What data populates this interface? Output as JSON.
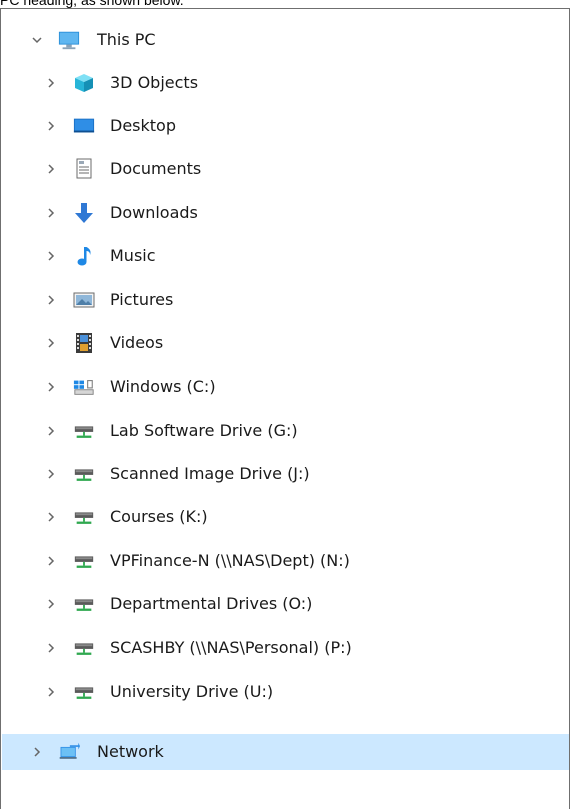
{
  "caption": "PC heading, as shown below.",
  "tree": {
    "root": {
      "label": "This PC",
      "icon": "computer-icon",
      "expanded": true
    },
    "children": [
      {
        "label": "3D Objects",
        "icon": "3d-objects-icon"
      },
      {
        "label": "Desktop",
        "icon": "desktop-icon"
      },
      {
        "label": "Documents",
        "icon": "documents-icon"
      },
      {
        "label": "Downloads",
        "icon": "downloads-icon"
      },
      {
        "label": "Music",
        "icon": "music-icon"
      },
      {
        "label": "Pictures",
        "icon": "pictures-icon"
      },
      {
        "label": "Videos",
        "icon": "videos-icon"
      },
      {
        "label": "Windows (C:)",
        "icon": "windows-drive-icon"
      },
      {
        "label": "Lab Software Drive (G:)",
        "icon": "network-drive-icon"
      },
      {
        "label": "Scanned Image Drive (J:)",
        "icon": "network-drive-icon"
      },
      {
        "label": "Courses (K:)",
        "icon": "network-drive-icon"
      },
      {
        "label": "VPFinance-N (\\\\NAS\\Dept) (N:)",
        "icon": "network-drive-icon"
      },
      {
        "label": "Departmental Drives (O:)",
        "icon": "network-drive-icon"
      },
      {
        "label": "SCASHBY (\\\\NAS\\Personal) (P:)",
        "icon": "network-drive-icon"
      },
      {
        "label": "University Drive (U:)",
        "icon": "network-drive-icon"
      }
    ],
    "network": {
      "label": "Network",
      "icon": "network-icon",
      "selected": true
    }
  },
  "colors": {
    "selection": "#cce8ff",
    "chevron": "#666666",
    "text": "#1a1a1a"
  }
}
